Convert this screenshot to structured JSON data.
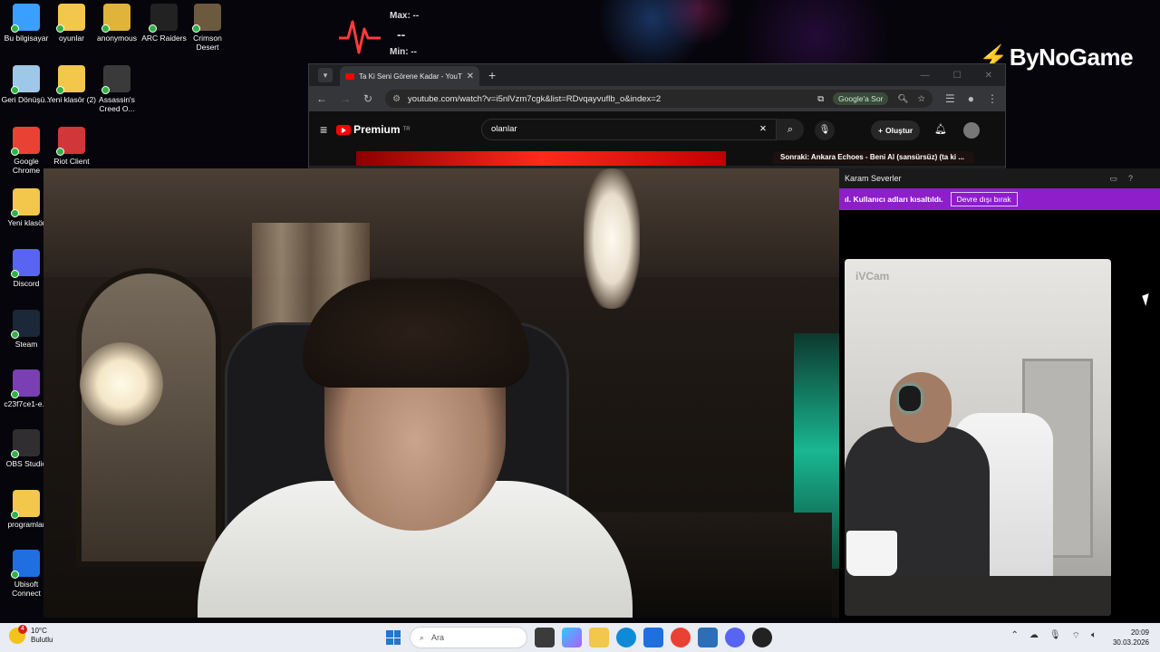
{
  "desktop": {
    "icons": [
      {
        "label": "Bu bilgisayar",
        "color": "#3aa0ff"
      },
      {
        "label": "oyunlar",
        "color": "#f3c64c"
      },
      {
        "label": "anonymous",
        "color": "#e0b43a"
      },
      {
        "label": "ARC Raiders",
        "color": "#222222"
      },
      {
        "label": "Crimson Desert",
        "color": "#6b5a3e"
      },
      {
        "label": "Geri Dönüşü...",
        "color": "#9ec7e8"
      },
      {
        "label": "Yeni klasör (2)",
        "color": "#f3c64c"
      },
      {
        "label": "Assassin's Creed O...",
        "color": "#3a3a3a"
      },
      {
        "label": "Google Chrome",
        "color": "#e94235"
      },
      {
        "label": "Riot Client",
        "color": "#d13639"
      },
      {
        "label": "Yeni klasör",
        "color": "#f3c64c"
      },
      {
        "label": "Discord",
        "color": "#5865f2"
      },
      {
        "label": "Steam",
        "color": "#1b2838"
      },
      {
        "label": "c23f7ce1-e...",
        "color": "#7a3fb3"
      },
      {
        "label": "OBS Studio",
        "color": "#302e31"
      },
      {
        "label": "programlar",
        "color": "#f3c64c"
      },
      {
        "label": "Ubisoft Connect",
        "color": "#1f6fe0"
      }
    ]
  },
  "heart_widget": {
    "max": "Max: --",
    "value": "--",
    "min": "Min: --"
  },
  "logo": {
    "text": "ByNoGame"
  },
  "browser": {
    "tab_title": "Ta Ki Seni Görene Kadar - YouTube",
    "url": "youtube.com/watch?v=i5nlVzm7cgk&list=RDvqayvuflb_o&index=2",
    "google_sor": "Google'a Sor",
    "search_value": "olanlar",
    "premium": "Premium",
    "premium_region": "TR",
    "create_label": "Oluştur",
    "up_next": "Sonraki: Ankara Echoes - Beni Al (sansürsüz) (ta ki ..."
  },
  "panel": {
    "title": "Karam Severler",
    "banner_text": "ıl. Kullanıcı adları kısaltıldı.",
    "banner_button": "Devre dışı bırak",
    "cam_watermark": "iVCam"
  },
  "taskbar": {
    "temp": "10°C",
    "weather": "Bulutlu",
    "weather_badge": "4",
    "search_placeholder": "Ara",
    "time": "20:09",
    "date": "30.03.2026"
  }
}
